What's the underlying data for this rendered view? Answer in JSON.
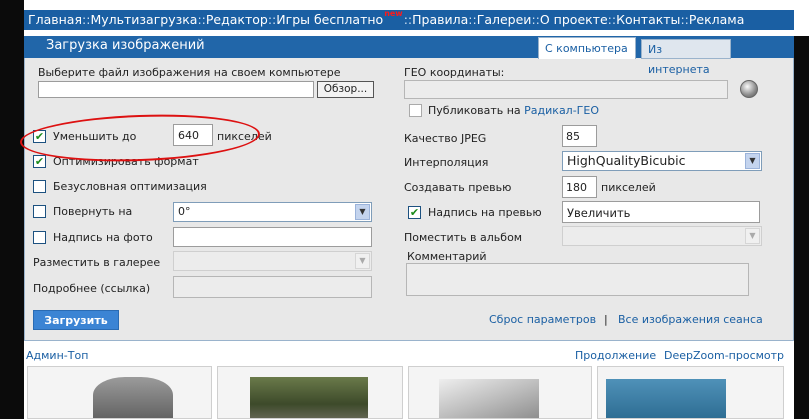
{
  "nav": {
    "items": [
      "Главная",
      "Мультизагрузка",
      "Редактор",
      "Игры бесплатно",
      "Правила",
      "Галереи",
      "О проекте",
      "Контакты",
      "Реклама"
    ],
    "separator": "::",
    "new_badge": "new"
  },
  "panel": {
    "title": "Загрузка изображений",
    "tabs": [
      "С компьютера",
      "Из интернета"
    ]
  },
  "file": {
    "label": "Выберите файл изображения на своем компьютере",
    "value": "",
    "browse_label": "Обзор..."
  },
  "left": {
    "reduce_label": "Уменьшить до",
    "reduce_value": "640",
    "reduce_unit": "пикселей",
    "optimize_label": "Оптимизировать формат",
    "unconditional_label": "Безусловная оптимизация",
    "rotate_label": "Повернуть на",
    "rotate_value": "0°",
    "caption_label": "Надпись на фото",
    "caption_value": "",
    "gallery_label": "Разместить в галерее",
    "more_label": "Подробнее (ссылка)",
    "more_value": ""
  },
  "right": {
    "geo_label": "ГЕО координаты:",
    "geo_value": "",
    "publish_prefix": "Публиковать на",
    "publish_link": "Радикал-ГЕО",
    "jpeg_label": "Качество JPEG",
    "jpeg_value": "85",
    "interp_label": "Интерполяция",
    "interp_value": "HighQualityBicubic",
    "preview_label": "Создавать превью",
    "preview_value": "180",
    "preview_unit": "пикселей",
    "preview_caption_label": "Надпись на превью",
    "preview_caption_value": "Увеличить",
    "album_label": "Поместить в альбом",
    "comment_label": "Комментарий",
    "comment_value": ""
  },
  "actions": {
    "upload": "Загрузить",
    "reset": "Сброс параметров",
    "divider": "|",
    "all_images": "Все изображения сеанса"
  },
  "gallery": {
    "left_link": "Админ-Топ",
    "continue_link": "Продолжение",
    "deepzoom_link": "DeepZoom-просмотр"
  },
  "checkboxes": {
    "reduce": true,
    "optimize": true,
    "unconditional": false,
    "rotate": false,
    "caption": false,
    "publish": false,
    "preview_caption": true
  },
  "colors": {
    "nav_bg": "#1a5fa3",
    "header_bg": "#2166a9",
    "panel_bg": "#e8e8e8",
    "upload_btn": "#3b84d4",
    "annotation": "#dd1111",
    "link": "#1a5fa3"
  },
  "icons": [
    "globe-icon",
    "check-icon",
    "chevron-down-icon"
  ]
}
